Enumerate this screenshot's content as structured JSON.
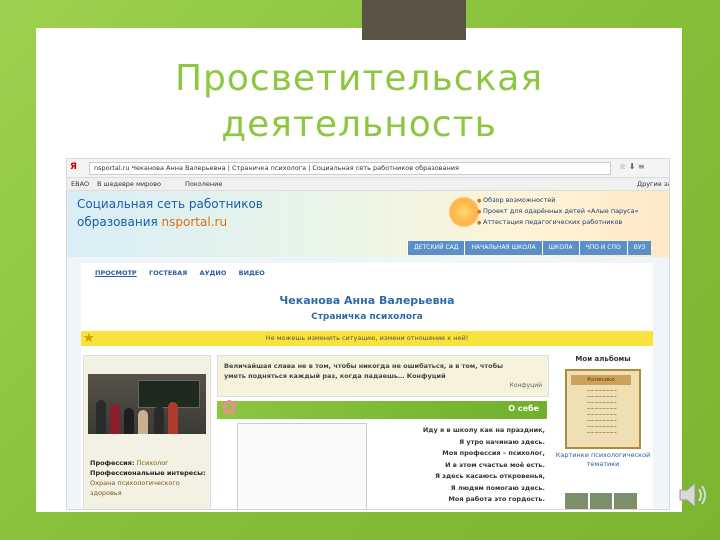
{
  "slide": {
    "title_line1": "Просветительская",
    "title_line2": "деятельность"
  },
  "browser": {
    "yandex_logo": "Я",
    "url_text": "nsportal.ru Чеканова Анна Валерьевна | Страничка психолога | Социальная сеть работников образования",
    "bookmarks": [
      "ЕВАО",
      "В шедевре мирово",
      "Поколение"
    ],
    "bookmarks_right": "Другие за"
  },
  "site": {
    "logo_line1": "Социальная сеть работников",
    "logo_line2_prefix": "образования ",
    "logo_ns": "ns",
    "logo_portal": "portal.ru",
    "menu": [
      "Обзор возможностей",
      "Проект для одарённых детей «Алые паруса»",
      "Аттестация педагогических работников"
    ],
    "nav_tabs": [
      "ДЕТСКИЙ САД",
      "НАЧАЛЬНАЯ ШКОЛА",
      "ШКОЛА",
      "ЧПО И СПО",
      "ВУЗ"
    ]
  },
  "page": {
    "tabs": [
      "ПРОСМОТР",
      "ГОСТЕВАЯ",
      "АУДИО",
      "ВИДЕО"
    ],
    "name": "Чеканова Анна Валерьевна",
    "role": "Страничка психолога",
    "top_quote": "Не можешь изменить ситуацию, измени отношение к ней!",
    "quote_text": "Величайшая слава не в том, чтобы никогда не ошибаться, а в том, чтобы уметь подняться каждый раз, когда падаешь… Конфуций",
    "quote_author": "Конфуций",
    "about_label": "О себе",
    "profession_label": "Профессия:",
    "profession_value": "Психолог",
    "interests_label": "Профессиональные интересы:",
    "interests_value": "Охрана психологического здоровья",
    "poem": [
      "Иду я в школу как на праздник,",
      "Я утро начинаю здесь.",
      "Моя профессия – психолог,",
      "И в этом счастье моё есть.",
      "Я здесь касаюсь откровенья,",
      "Я людям помогаю здесь.",
      "Моя работа это гордость."
    ],
    "albums_heading": "Мои альбомы",
    "album_cover_title": "Колесико",
    "album_caption": "Картинки психологической тематики"
  }
}
